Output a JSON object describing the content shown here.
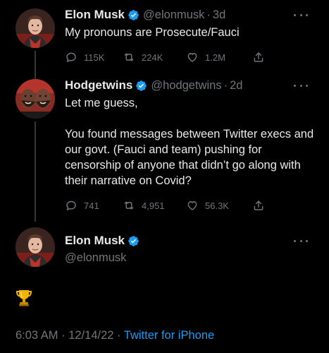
{
  "colors": {
    "background": "#000000",
    "text": "#e7e9ea",
    "muted": "#71767b",
    "accent": "#1d9bf0",
    "verified": "#1d9bf0"
  },
  "tweet1": {
    "name": "Elon Musk",
    "handle": "@elonmusk",
    "separator": "·",
    "time": "3d",
    "text": "My pronouns are Prosecute/Fauci",
    "replies": "115K",
    "retweets": "224K",
    "likes": "1.2M"
  },
  "tweet2": {
    "name": "Hodgetwins",
    "handle": "@hodgetwins",
    "separator": "·",
    "time": "2d",
    "text": "Let me guess,\n\nYou found messages between Twitter execs and our govt. (Fauci and team) pushing for censorship of anyone that didn’t go along with their narrative on Covid?",
    "replies": "741",
    "retweets": "4,951",
    "likes": "56.3K"
  },
  "main_tweet": {
    "name": "Elon Musk",
    "handle": "@elonmusk",
    "content_icon": "trophy-emoji",
    "timestamp": "6:03 AM · 12/14/22 · ",
    "client": "Twitter for iPhone"
  },
  "icons": {
    "reply": "reply-icon",
    "retweet": "retweet-icon",
    "like": "like-icon",
    "share": "share-icon",
    "more": "more-icon",
    "verified": "verified-badge-icon"
  }
}
